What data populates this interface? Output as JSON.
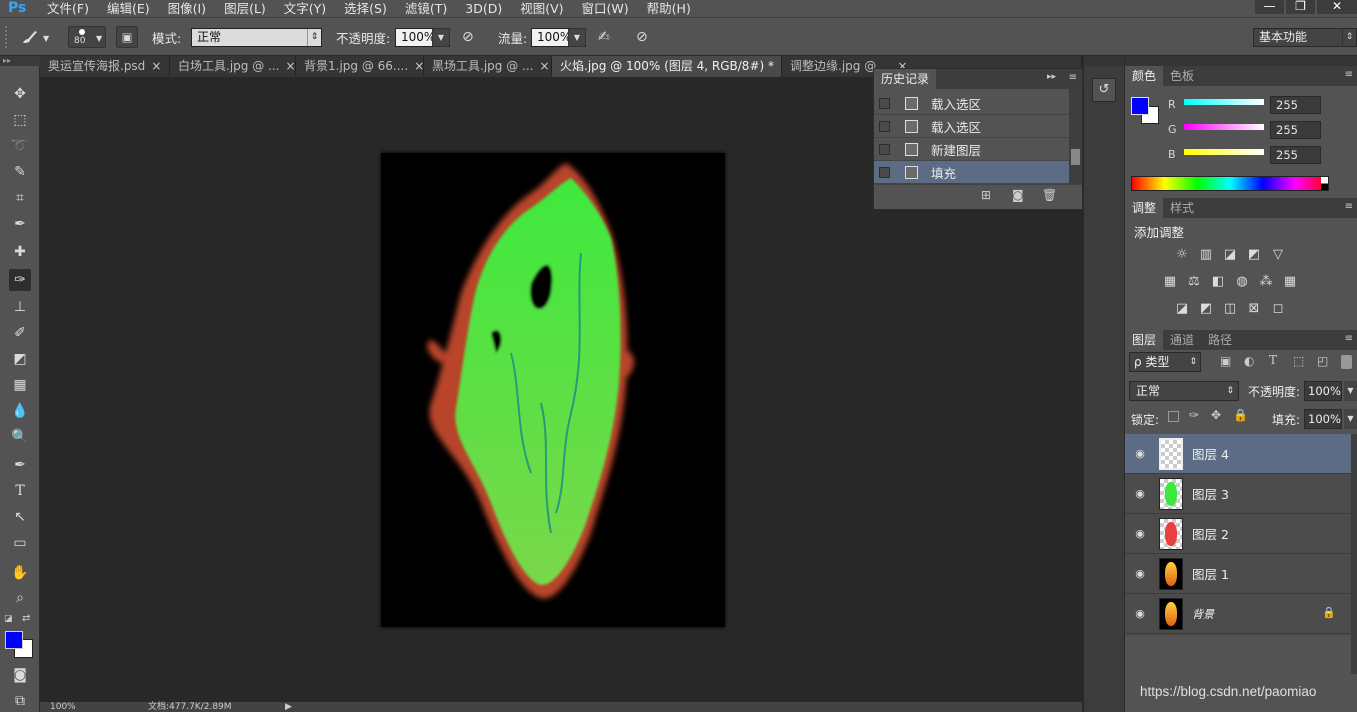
{
  "menubar": {
    "logo": "Ps",
    "items": [
      "文件(F)",
      "编辑(E)",
      "图像(I)",
      "图层(L)",
      "文字(Y)",
      "选择(S)",
      "滤镜(T)",
      "3D(D)",
      "视图(V)",
      "窗口(W)",
      "帮助(H)"
    ],
    "window_controls": [
      "—",
      "❐",
      "✕"
    ]
  },
  "options": {
    "brush_size": "80",
    "mode_label": "模式:",
    "mode_value": "正常",
    "opacity_label": "不透明度:",
    "opacity_value": "100%",
    "flow_label": "流量:",
    "flow_value": "100%",
    "workspace": "基本功能"
  },
  "tabs": [
    {
      "label": "奥运宣传海报.psd",
      "close": "×"
    },
    {
      "label": "白场工具.jpg @ ...",
      "close": "×"
    },
    {
      "label": "背景1.jpg @ 66....",
      "close": "×"
    },
    {
      "label": "黑场工具.jpg @ ...",
      "close": "×"
    },
    {
      "label": "火焰.jpg @ 100% (图层 4, RGB/8#) *",
      "close": "×"
    },
    {
      "label": "调整边缘.jpg @ ...",
      "close": "×"
    }
  ],
  "history": {
    "tabs": [
      "历史记录"
    ],
    "items": [
      "载入选区",
      "载入选区",
      "新建图层",
      "填充"
    ],
    "selected_index": 3
  },
  "color_panel": {
    "tabs": [
      "颜色",
      "色板"
    ],
    "foreground": "#0000ff",
    "background": "#ffffff",
    "channels": [
      {
        "name": "R",
        "value": "255",
        "color": "#00ffff"
      },
      {
        "name": "G",
        "value": "255",
        "color": "#ff00ff"
      },
      {
        "name": "B",
        "value": "255",
        "color": "#ffff00"
      }
    ]
  },
  "adjustments": {
    "tabs": [
      "调整",
      "样式"
    ],
    "title": "添加调整",
    "icons": [
      "brightness-icon",
      "levels-icon",
      "curves-icon",
      "exposure-icon",
      "vibrance-icon",
      "hue-icon",
      "color-balance-icon",
      "black-white-icon",
      "photo-filter-icon",
      "channel-mixer-icon",
      "color-lookup-icon",
      "invert-icon",
      "posterize-icon",
      "threshold-icon",
      "gradient-map-icon",
      "selective-color-icon"
    ]
  },
  "layers_panel": {
    "tabs": [
      "图层",
      "通道",
      "路径"
    ],
    "filter_label": "ρ 类型",
    "blend_mode": "正常",
    "opacity_label": "不透明度:",
    "opacity_value": "100%",
    "lock_label": "锁定:",
    "fill_label": "填充:",
    "fill_value": "100%",
    "layers": [
      {
        "name": "图层 4",
        "thumb": "transparent",
        "selected": true
      },
      {
        "name": "图层 3",
        "thumb": "green-fire"
      },
      {
        "name": "图层 2",
        "thumb": "red-fire"
      },
      {
        "name": "图层 1",
        "thumb": "fire"
      },
      {
        "name": "背景",
        "thumb": "fire",
        "locked": true
      }
    ]
  },
  "statusbar": {
    "zoom": "100%",
    "doc_info": "文档:477.7K/2.89M"
  },
  "watermark": "https://blog.csdn.net/paomiao"
}
